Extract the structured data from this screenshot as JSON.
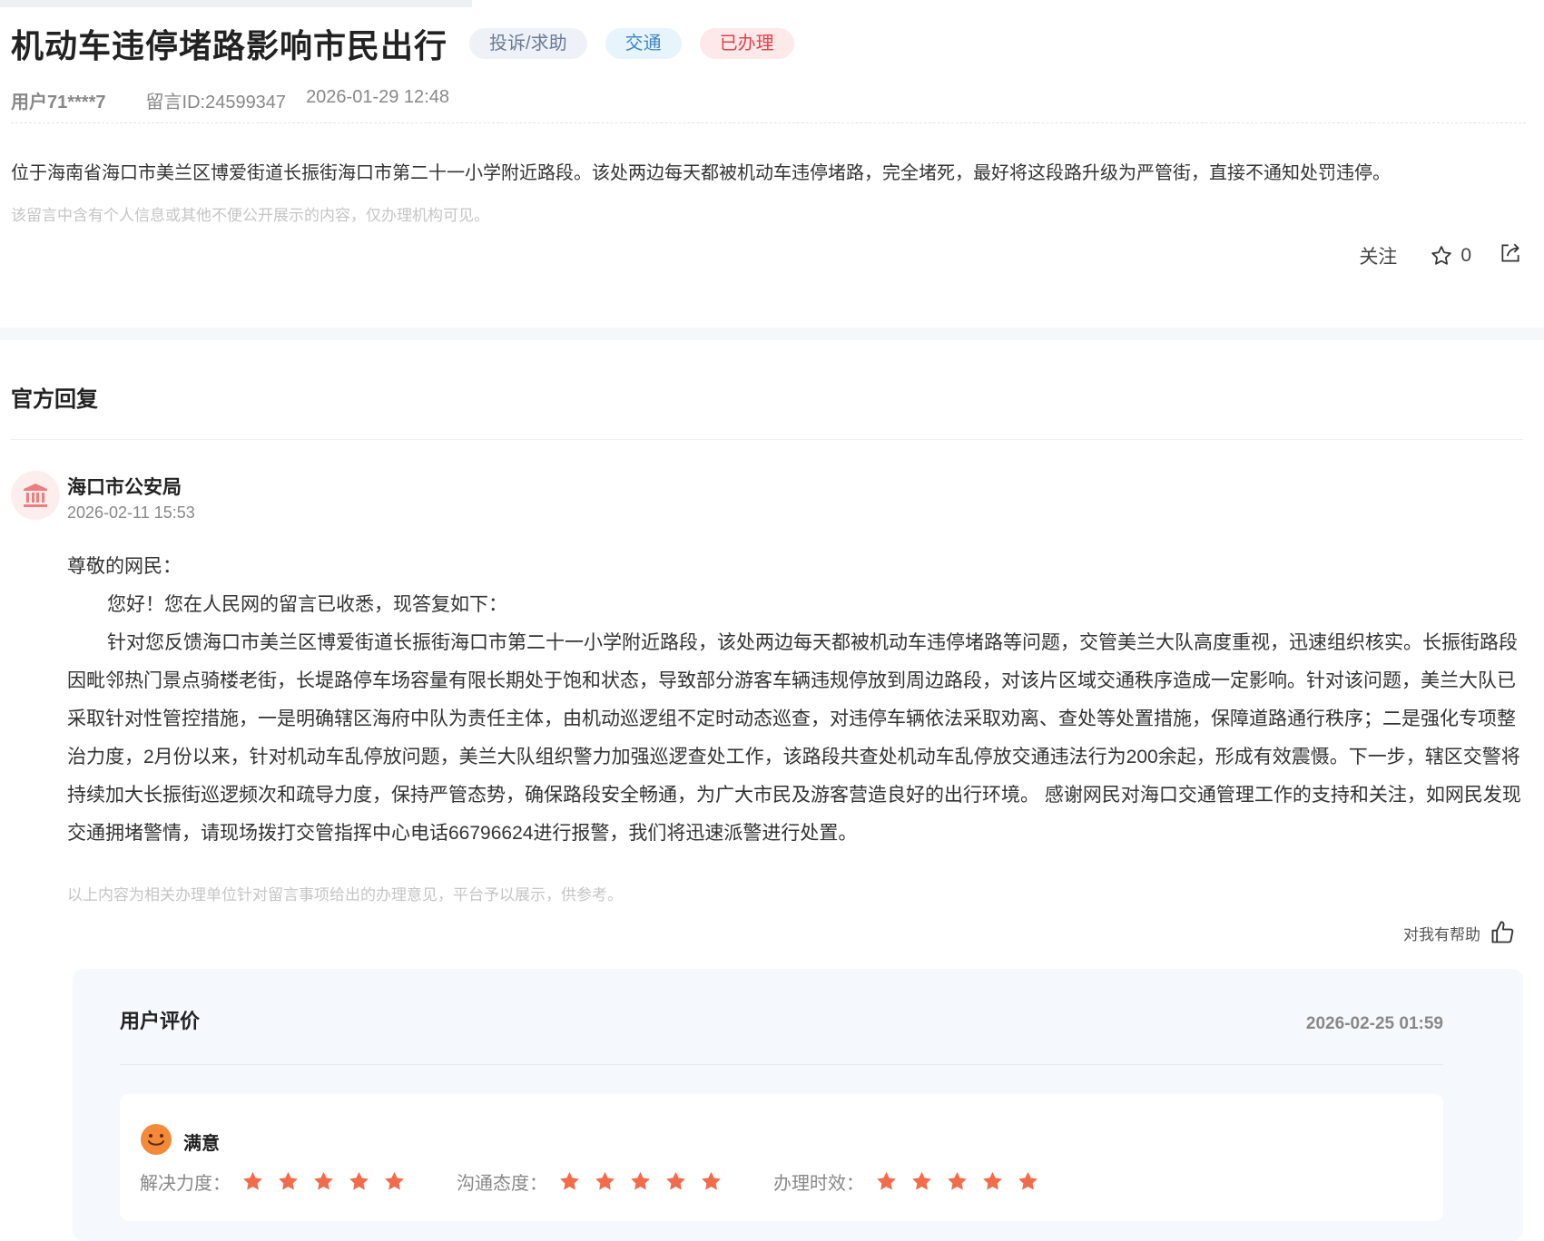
{
  "post": {
    "title": "机动车违停堵路影响市民出行",
    "tags": {
      "type": "投诉/求助",
      "field": "交通",
      "status": "已办理"
    },
    "user": "用户71****7",
    "message_id": "留言ID:24599347",
    "datetime": "2026-01-29 12:48",
    "content": "位于海南省海口市美兰区博爱街道长振街海口市第二十一小学附近路段。该处两边每天都被机动车违停堵路，完全堵死，最好将这段路升级为严管街，直接不通知处罚违停。",
    "privacy_notice": "该留言中含有个人信息或其他不便公开展示的内容，仅办理机构可见。",
    "actions": {
      "follow": "关注",
      "star_count": "0"
    }
  },
  "reply": {
    "section_title": "官方回复",
    "org": "海口市公安局",
    "date": "2026-02-11 15:53",
    "salutation": "尊敬的网民：",
    "greeting": "您好！您在人民网的留言已收悉，现答复如下：",
    "body": "针对您反馈海口市美兰区博爱街道长振街海口市第二十一小学附近路段，该处两边每天都被机动车违停堵路等问题，交管美兰大队高度重视，迅速组织核实。长振街路段因毗邻热门景点骑楼老街，长堤路停车场容量有限长期处于饱和状态，导致部分游客车辆违规停放到周边路段，对该片区域交通秩序造成一定影响。针对该问题，美兰大队已采取针对性管控措施，一是明确辖区海府中队为责任主体，由机动巡逻组不定时动态巡查，对违停车辆依法采取劝离、查处等处置措施，保障道路通行秩序；二是强化专项整治力度，2月份以来，针对机动车乱停放问题，美兰大队组织警力加强巡逻查处工作，该路段共查处机动车乱停放交通违法行为200余起，形成有效震慑。下一步，辖区交警将持续加大长振街巡逻频次和疏导力度，保持严管态势，确保路段安全畅通，为广大市民及游客营造良好的出行环境。 感谢网民对海口交通管理工作的支持和关注，如网民发现交通拥堵警情，请现场拨打交管指挥中心电话66796624进行报警，我们将迅速派警进行处置。",
    "notice": "以上内容为相关办理单位针对留言事项给出的办理意见，平台予以展示，供参考。",
    "helpful": "对我有帮助"
  },
  "evaluation": {
    "title": "用户评价",
    "date": "2026-02-25 01:59",
    "satisfaction": "满意",
    "ratings": [
      {
        "label": "解决力度：",
        "stars": 5
      },
      {
        "label": "沟通态度：",
        "stars": 5
      },
      {
        "label": "办理时效：",
        "stars": 5
      }
    ]
  },
  "colors": {
    "star": "#f26b4b",
    "status_red": "#e0424c",
    "field_blue": "#3b86c4"
  }
}
